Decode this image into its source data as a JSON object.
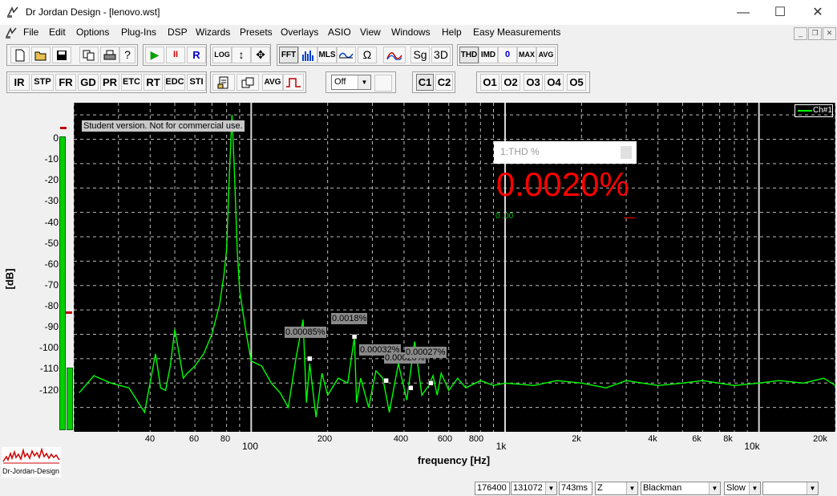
{
  "window": {
    "title": "Dr Jordan Design - [lenovo.wst]",
    "minimize": "—",
    "maximize": "☐",
    "close": "✕"
  },
  "menu": [
    "File",
    "Edit",
    "Options",
    "Plug-Ins",
    "DSP",
    "Wizards",
    "Presets",
    "Overlays",
    "ASIO",
    "View",
    "Windows",
    "Help",
    "Easy Measurements"
  ],
  "toolbar1": {
    "left_icons": [
      "new-file-icon",
      "open-folder-icon",
      "save-icon",
      "copy-icon",
      "print-icon",
      "help-icon"
    ],
    "run": {
      "play": "▶",
      "pause": "II",
      "record": "R"
    },
    "scale": {
      "log": "LOG",
      "vertical": "↕",
      "move": "✥"
    },
    "modes": [
      "FFT",
      "",
      "MLS",
      "",
      "Ω",
      "",
      "Sg",
      "3D"
    ],
    "meters": [
      "THD",
      "IMD",
      "0",
      "MAX",
      "AVG"
    ]
  },
  "toolbar2": {
    "analysis": [
      "IR",
      "STP",
      "FR",
      "GD",
      "PR",
      "ETC",
      "RT",
      "EDC",
      "STI"
    ],
    "avg_label": "AVG",
    "select_value": "Off",
    "channels": [
      "C1",
      "C2"
    ],
    "outputs": [
      "O1",
      "O2",
      "O3",
      "O4",
      "O5"
    ]
  },
  "plot": {
    "watermark": "Student version. Not for commercial use.",
    "legend": "Ch#1",
    "ylabel": "[dB]",
    "xlabel": "frequency [Hz]",
    "yticks": [
      "0",
      "-10",
      "-20",
      "-30",
      "-40",
      "-50",
      "-60",
      "-70",
      "-80",
      "-90",
      "-100",
      "-110",
      "-120"
    ],
    "xticks_minor": [
      "40",
      "60",
      "80",
      "200",
      "400",
      "600",
      "800",
      "2k",
      "4k",
      "6k",
      "8k",
      "20k"
    ],
    "xticks_major": [
      "100",
      "1k",
      "10k"
    ],
    "harmonic_labels": [
      "0.00085%",
      "0.0018%",
      "0.00032%",
      "0.00020%",
      "0.00027%"
    ],
    "thd_box": {
      "title": "1:THD %",
      "value": "0.0020%",
      "bar_left": "0 .00"
    }
  },
  "logo_text": "Dr-Jordan-Design",
  "status": {
    "rate": "176400",
    "fft_size": "131072",
    "time": "743ms",
    "weighting": "Z",
    "window": "Blackman",
    "speed": "Slow",
    "extra": ""
  },
  "colors": {
    "trace": "#00ff00",
    "thd_value": "#ff0000",
    "plot_bg": "#000000",
    "meter_green": "#00d000",
    "meter_marker": "#c00000"
  },
  "chart_data": {
    "type": "line",
    "title": "",
    "xlabel": "frequency [Hz]",
    "ylabel": "[dB]",
    "xscale": "log",
    "xlim": [
      20,
      20000
    ],
    "ylim": [
      -130,
      5
    ],
    "grid": true,
    "legend_position": "top-right",
    "series": [
      {
        "name": "Ch#1",
        "x": [
          21,
          24,
          28,
          33,
          38,
          42,
          44,
          46,
          48,
          50,
          52,
          54,
          56,
          60,
          65,
          70,
          75,
          78,
          80,
          82,
          84,
          86,
          88,
          90,
          95,
          100,
          110,
          120,
          130,
          140,
          150,
          160,
          165,
          170,
          180,
          190,
          200,
          220,
          240,
          255,
          260,
          270,
          290,
          310,
          330,
          350,
          380,
          410,
          440,
          470,
          500,
          520,
          540,
          560,
          600,
          650,
          700,
          800,
          900,
          1000,
          1300,
          1600,
          2000,
          2500,
          3000,
          4000,
          5000,
          6000,
          8000,
          10000,
          12000,
          15000,
          18000,
          20000
        ],
        "y": [
          -114,
          -107,
          -110,
          -112,
          -122,
          -98,
          -112,
          -113,
          -103,
          -88,
          -98,
          -108,
          -106,
          -103,
          -98,
          -90,
          -78,
          -66,
          -55,
          -25,
          0,
          -25,
          -55,
          -72,
          -88,
          -101,
          -103,
          -110,
          -114,
          -120,
          -100,
          -84,
          -118,
          -102,
          -124,
          -106,
          -115,
          -108,
          -110,
          -91,
          -118,
          -108,
          -120,
          -105,
          -108,
          -122,
          -102,
          -117,
          -93,
          -115,
          -111,
          -107,
          -115,
          -106,
          -113,
          -108,
          -112,
          -109,
          -111,
          -110,
          -111,
          -109,
          -110,
          -112,
          -109,
          -111,
          -110,
          -109,
          -111,
          -110,
          -109,
          -110,
          -108,
          -111
        ]
      }
    ],
    "annotations": [
      {
        "label": "0.00085%",
        "x": 170,
        "y": -100
      },
      {
        "label": "0.0018%",
        "x": 255,
        "y": -91
      },
      {
        "label": "0.00032%",
        "x": 340,
        "y": -109
      },
      {
        "label": "0.00020%",
        "x": 425,
        "y": -112
      },
      {
        "label": "0.00027%",
        "x": 510,
        "y": -110
      }
    ]
  }
}
